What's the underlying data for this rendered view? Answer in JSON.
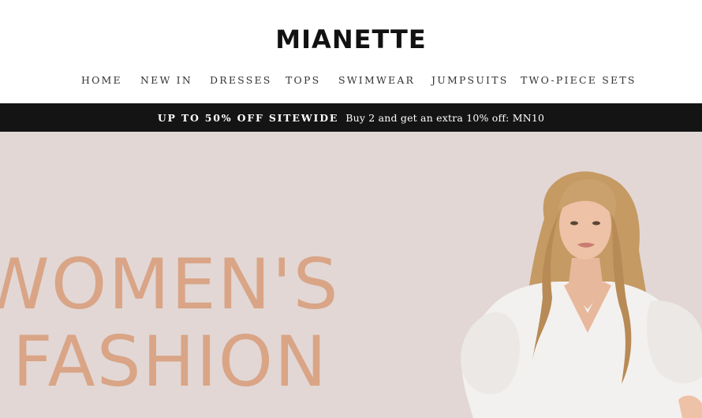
{
  "header": {
    "logo": "MIANETTE",
    "nav": [
      "HOME",
      "NEW IN",
      "DRESSES",
      "TOPS",
      "SWIMWEAR",
      "JUMPSUITS",
      "TWO-PIECE SETS"
    ]
  },
  "promo": {
    "headline": "UP TO 50% OFF SITEWIDE",
    "text": "Buy 2 and get an extra 10% off: MN10"
  },
  "hero": {
    "line1": "WOMEN'S",
    "line2": "FASHION",
    "image_label": "model-photo"
  },
  "colors": {
    "promo_bg": "#141414",
    "hero_bg": "#e2d7d5",
    "hero_text": "#d9a586"
  }
}
